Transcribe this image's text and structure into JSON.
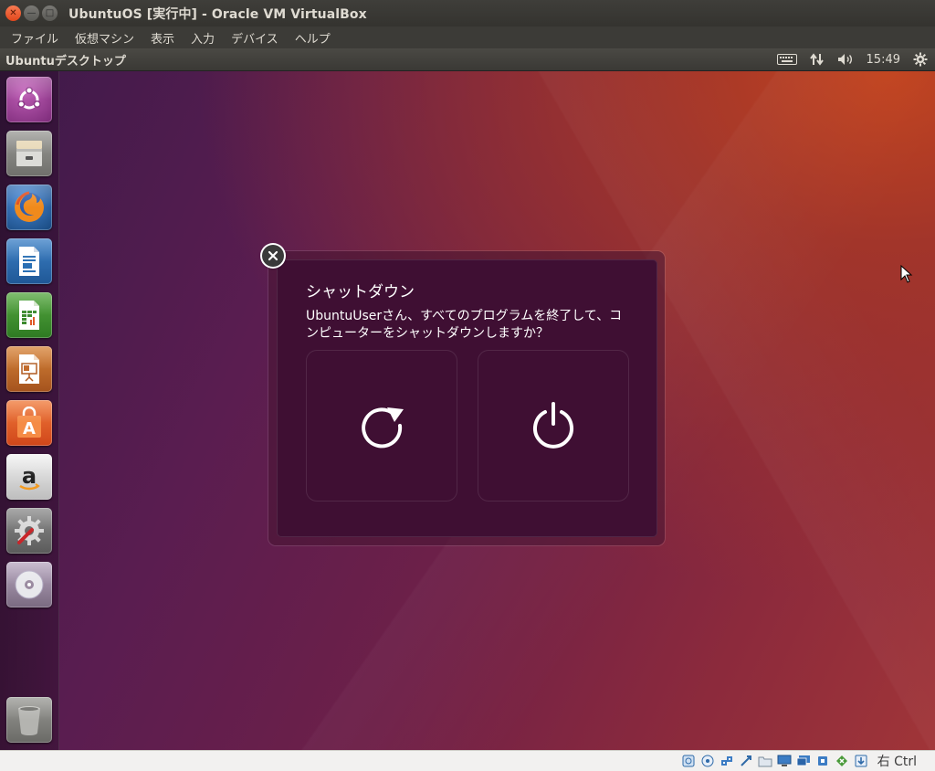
{
  "window": {
    "title": "UbuntuOS [実行中] - Oracle VM VirtualBox",
    "close_glyph": "✕",
    "minimize_glyph": "—",
    "maximize_glyph": "□"
  },
  "menubar": {
    "items": [
      "ファイル",
      "仮想マシン",
      "表示",
      "入力",
      "デバイス",
      "ヘルプ"
    ]
  },
  "ubuntu_panel": {
    "title": "Ubuntuデスクトップ",
    "clock": "15:49",
    "indicators": [
      "keyboard-icon",
      "network-icon",
      "volume-icon",
      "gear-icon"
    ]
  },
  "launcher": {
    "items": [
      {
        "name": "dash-home",
        "icon": "ubuntu-logo-icon",
        "color": "#8e3a8a"
      },
      {
        "name": "files",
        "icon": "file-cabinet-icon",
        "color": "#8a8a86"
      },
      {
        "name": "firefox",
        "icon": "firefox-icon",
        "color": "#1f5fa6"
      },
      {
        "name": "libreoffice-writer",
        "icon": "writer-document-icon",
        "color": "#2a6fb4"
      },
      {
        "name": "libreoffice-calc",
        "icon": "calc-spreadsheet-icon",
        "color": "#3c8a2e"
      },
      {
        "name": "libreoffice-impress",
        "icon": "impress-presentation-icon",
        "color": "#c26a2a"
      },
      {
        "name": "software-center",
        "icon": "shopping-bag-icon",
        "color": "#e35a20"
      },
      {
        "name": "amazon",
        "icon": "amazon-icon",
        "color": "#d0d0d0"
      },
      {
        "name": "system-settings",
        "icon": "settings-tools-icon",
        "color": "#7a7a7a"
      },
      {
        "name": "dvd",
        "icon": "disc-icon",
        "color": "#9a8aa0"
      },
      {
        "name": "trash",
        "icon": "trash-icon",
        "color": "#8a8a86"
      }
    ]
  },
  "dialog": {
    "close_glyph": "✕",
    "title": "シャットダウン",
    "message": "UbuntuUserさん、すべてのプログラムを終了して、コンピューターをシャットダウンしますか？",
    "buttons": [
      {
        "name": "restart",
        "icon": "restart-icon"
      },
      {
        "name": "power-off",
        "icon": "power-icon"
      }
    ]
  },
  "statusbar": {
    "icons": [
      "hard-disk-icon",
      "optical-disk-icon",
      "network-adapter-icon",
      "usb-icon",
      "shared-folders-icon",
      "display-icon",
      "video-capture-icon",
      "cpu-icon",
      "mouse-integration-icon",
      "keyboard-capture-icon"
    ],
    "host_key": "右 Ctrl"
  },
  "colors": {
    "ubuntu_orange": "#e95420",
    "dialog_bg": "#3f0f33"
  }
}
